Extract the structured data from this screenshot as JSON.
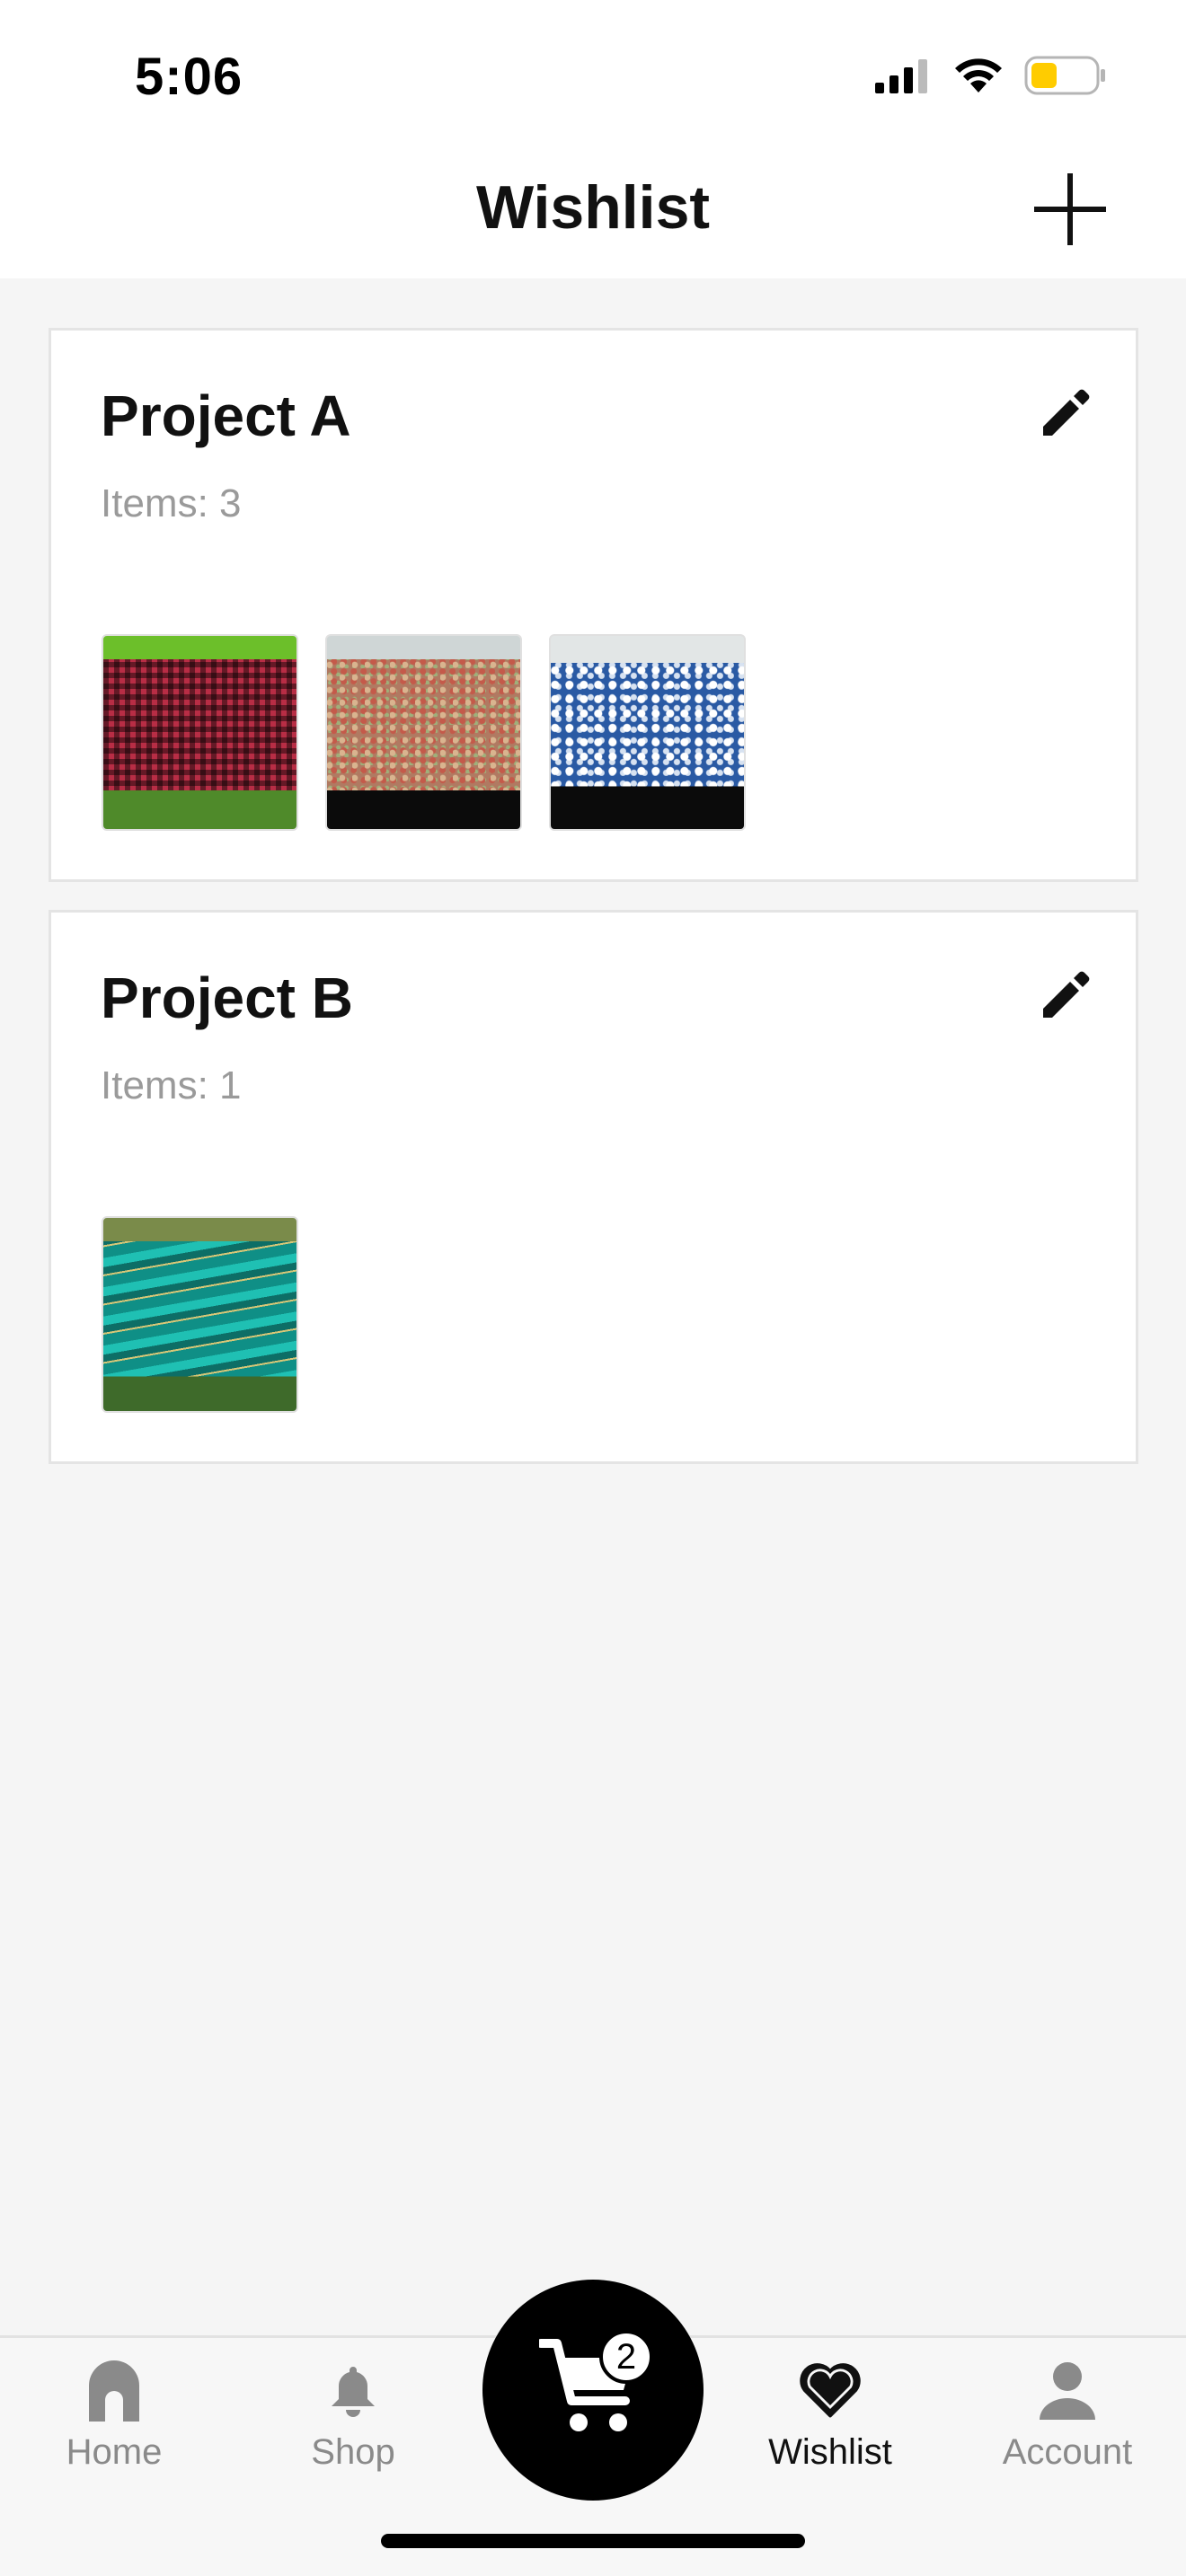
{
  "status_bar": {
    "time": "5:06",
    "icons": [
      "cellular-signal-icon",
      "wifi-icon",
      "battery-icon"
    ],
    "battery_color": "#ffcc00"
  },
  "header": {
    "title": "Wishlist",
    "add_icon": "plus-icon"
  },
  "projects": [
    {
      "title": "Project A",
      "count_label": "Items: 3",
      "edit_icon": "pencil-icon",
      "items": [
        "red-plaid-fabric",
        "speckled-glitter-fabric",
        "blue-paisley-fabric"
      ]
    },
    {
      "title": "Project B",
      "count_label": "Items: 1",
      "edit_icon": "pencil-icon",
      "items": [
        "teal-marble-fabric"
      ]
    }
  ],
  "tabbar": {
    "home": "Home",
    "shop": "Shop",
    "wishlist": "Wishlist",
    "account": "Account",
    "active": "Wishlist",
    "cart_count": "2"
  },
  "colors": {
    "background": "#f5f5f5",
    "card": "#ffffff",
    "text_primary": "#111111",
    "text_muted": "#9a9a9a",
    "fab": "#000000"
  }
}
